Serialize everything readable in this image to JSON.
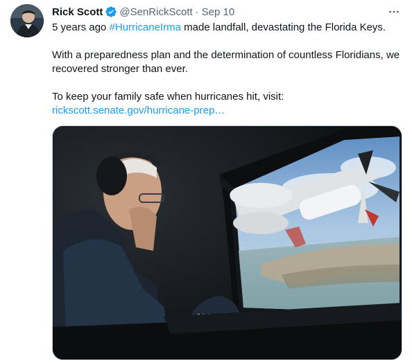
{
  "tweet": {
    "author_name": "Rick Scott",
    "handle": "@SenRickScott",
    "separator": "·",
    "date": "Sep 10",
    "text": {
      "line1_prefix": "5 years ago ",
      "hashtag": "#HurricaneIrma",
      "line1_suffix": " made landfall, devastating the Florida Keys.",
      "paragraph2": "With a preparedness plan and the determination of countless Floridians, we recovered stronger than ever.",
      "paragraph3": "To keep your family safe when hurricanes hit, visit:",
      "link": "rickscott.senate.gov/hurricane-prep…"
    },
    "photo_cap_text": "NAVY"
  },
  "icons": {
    "verified": "verified-badge-icon",
    "more": "more-options-icon"
  },
  "colors": {
    "link": "#1d9bf0",
    "secondary_text": "#536471",
    "primary_text": "#0f1419"
  }
}
